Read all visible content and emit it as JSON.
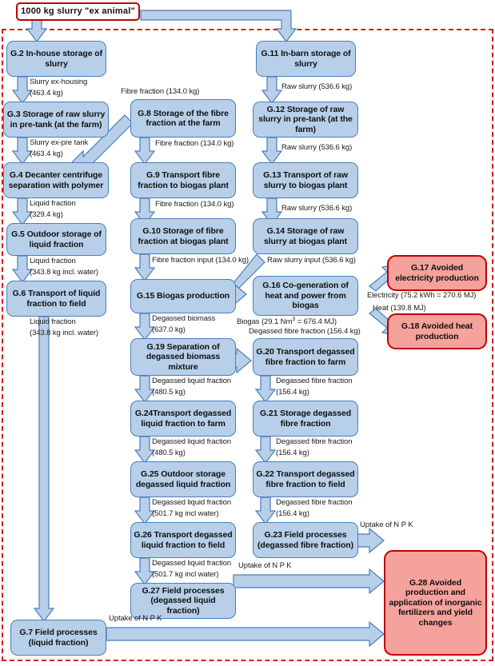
{
  "diagram": {
    "title": "Slurry treatment and biogas LCA flow diagram",
    "colors": {
      "box_fill": "#b7cfe8",
      "box_border": "#4a7ebb",
      "avoided_fill": "#f5a19c",
      "avoided_border": "#c00000",
      "boundary": "#d81a1a",
      "arrow_fill": "#b7cfe8",
      "arrow_border": "#4a7ebb"
    },
    "source": {
      "label": "1000 kg slurry \"ex animal\""
    },
    "nodes": [
      {
        "id": "G2",
        "label": "G.2 In-house storage of slurry"
      },
      {
        "id": "G3",
        "label": "G.3 Storage of raw slurry in pre-tank (at the farm)"
      },
      {
        "id": "G4",
        "label": "G.4 Decanter centrifuge separation with polymer"
      },
      {
        "id": "G5",
        "label": "G.5 Outdoor storage of liquid fraction"
      },
      {
        "id": "G6",
        "label": "G.6 Transport of liquid fraction to field"
      },
      {
        "id": "G7",
        "label": "G.7 Field processes (liquid fraction)"
      },
      {
        "id": "G8",
        "label": "G.8 Storage of the fibre fraction at the farm"
      },
      {
        "id": "G9",
        "label": "G.9 Transport fibre fraction to biogas plant"
      },
      {
        "id": "G10",
        "label": "G.10 Storage of fibre fraction at biogas plant"
      },
      {
        "id": "G11",
        "label": "G.11 In-barn storage of slurry"
      },
      {
        "id": "G12",
        "label": "G.12 Storage of raw slurry in pre-tank (at the farm)"
      },
      {
        "id": "G13",
        "label": "G.13 Transport of raw slurry to biogas plant"
      },
      {
        "id": "G14",
        "label": "G.14 Storage of raw slurry at biogas plant"
      },
      {
        "id": "G15",
        "label": "G.15 Biogas production"
      },
      {
        "id": "G16",
        "label": "G.16 Co-generation of heat and power from biogas"
      },
      {
        "id": "G17",
        "label": "G.17 Avoided electricity production"
      },
      {
        "id": "G18",
        "label": "G.18 Avoided heat production"
      },
      {
        "id": "G19",
        "label": "G.19 Separation of degassed biomass mixture"
      },
      {
        "id": "G20",
        "label": "G.20 Transport degassed fibre fraction to farm"
      },
      {
        "id": "G21",
        "label": "G.21 Storage degassed fibre fraction"
      },
      {
        "id": "G22",
        "label": "G.22 Transport degassed fibre fraction to field"
      },
      {
        "id": "G23",
        "label": "G.23 Field processes (degassed fibre fraction)"
      },
      {
        "id": "G24",
        "label": "G.24Transport degassed liquid fraction to farm"
      },
      {
        "id": "G25",
        "label": "G.25 Outdoor storage degassed liquid fraction"
      },
      {
        "id": "G26",
        "label": "G.26 Transport degassed liquid fraction to field"
      },
      {
        "id": "G27",
        "label": "G.27 Field processes (degassed liquid fraction)"
      },
      {
        "id": "G28",
        "label": "G.28 Avoided production and application of inorganic fertilizers and yield changes"
      }
    ],
    "flows": {
      "slurry_ex_housing": "Slurry ex-housing",
      "slurry_ex_housing_qty": "(463.4 kg)",
      "slurry_ex_pretank": "Slurry ex-pre tank",
      "slurry_ex_pretank_qty": "(463.4 kg)",
      "liquid_fraction": "Liquid fraction",
      "liquid_fraction_qty": "(329.4 kg)",
      "liquid_fraction2": "Liquid fraction",
      "liquid_fraction2_qty": "(343.8 kg incl. water)",
      "liquid_fraction3": "Liquid fraction",
      "liquid_fraction3_qty": "(343.8 kg incl. water)",
      "fibre_fraction_top": "Fibre fraction (134.0 kg)",
      "fibre_fraction_g8": "Fibre fraction (134.0 kg)",
      "fibre_fraction_g9": "Fibre fraction (134.0 kg)",
      "fibre_fraction_input": "Fibre fraction input (134.0 kg)",
      "raw_slurry_g11": "Raw slurry (536.6 kg)",
      "raw_slurry_g12": "Raw slurry (536.6 kg)",
      "raw_slurry_g13": "Raw slurry (536.6 kg)",
      "raw_slurry_input": "Raw slurry input (536.6 kg)",
      "degassed_biomass": "Degassed biomass",
      "degassed_biomass_qty": "(637.0 kg)",
      "biogas": "Biogas (29.1 Nm3 = 676.4 MJ)",
      "biogas_prefix": "Biogas (29.1 Nm",
      "biogas_sup": "3",
      "biogas_suffix": " = 676.4 MJ)",
      "degassed_fibre_g20": "Degassed fibre fraction (156.4 kg)",
      "electricity": "Electricity (75.2 kWh = 270.6 MJ)",
      "heat": "Heat (139.8 MJ)",
      "degassed_liquid_1": "Degassed liquid fraction",
      "degassed_liquid_1_qty": "(480.5 kg)",
      "degassed_liquid_2": "Degassed liquid fraction",
      "degassed_liquid_2_qty": "(480.5 kg)",
      "degassed_liquid_3": "Degassed liquid fraction",
      "degassed_liquid_3_qty": "(501.7 kg incl water)",
      "degassed_liquid_4": "Degassed liquid fraction",
      "degassed_liquid_4_qty": "(501.7 kg incl water)",
      "degassed_fibre_1": "Degassed fibre fraction",
      "degassed_fibre_1_qty": "(156.4 kg)",
      "degassed_fibre_2": "Degassed fibre fraction",
      "degassed_fibre_2_qty": "(156.4 kg)",
      "degassed_fibre_3": "Degassed fibre fraction",
      "degassed_fibre_3_qty": "(156.4 kg)",
      "uptake_g23": "Uptake of N P K",
      "uptake_g27": "Uptake of N P K",
      "uptake_g7": "Uptake of N P K"
    }
  }
}
